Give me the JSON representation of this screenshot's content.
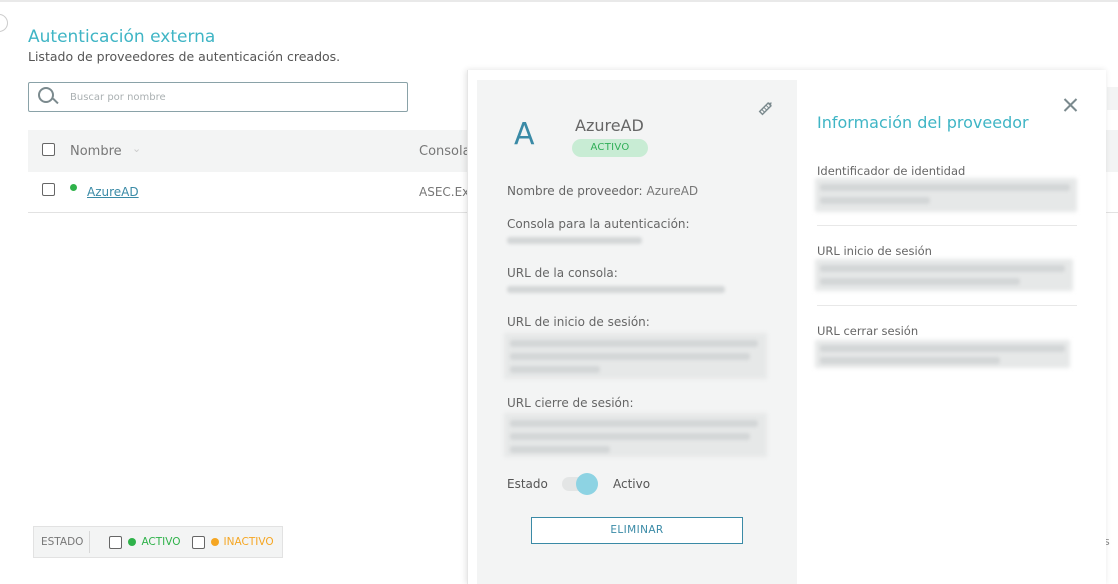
{
  "page": {
    "title": "Autenticación externa",
    "subtitle": "Listado de proveedores de autenticación creados."
  },
  "search": {
    "placeholder": "Buscar por nombre"
  },
  "table": {
    "columns": [
      "Nombre",
      "Consola"
    ],
    "rows": [
      {
        "name": "AzureAD",
        "console": "ASEC.Ex",
        "status_color": "#2fb24a"
      }
    ]
  },
  "filter": {
    "label": "ESTADO",
    "options": [
      {
        "label": "ACTIVO",
        "color": "#2fb24a"
      },
      {
        "label": "INACTIVO",
        "color": "#f5a623"
      }
    ]
  },
  "stray_text": "s",
  "provider": {
    "initial": "A",
    "name": "AzureAD",
    "badge": "ACTIVO",
    "fields": {
      "provider_name_label": "Nombre de proveedor:",
      "provider_name_value": "AzureAD",
      "auth_console_label": "Consola para la autenticación:",
      "console_url_label": "URL de la consola:",
      "login_url_label": "URL de inicio de sesión:",
      "logout_url_label": "URL cierre de sesión:"
    },
    "state_label": "Estado",
    "state_value": "Activo",
    "state_on": true,
    "delete_label": "ELIMINAR"
  },
  "info": {
    "title": "Información del proveedor",
    "identity_label": "Identificador de identidad",
    "login_label": "URL inicio de sesión",
    "logout_label": "URL cerrar sesión"
  },
  "colors": {
    "accent": "#3fb5c5",
    "link": "#3a8aa6",
    "active": "#2fb24a",
    "inactive": "#f5a623"
  },
  "icons": [
    "search-icon",
    "chevron-down-icon",
    "edit-icon",
    "close-icon"
  ]
}
